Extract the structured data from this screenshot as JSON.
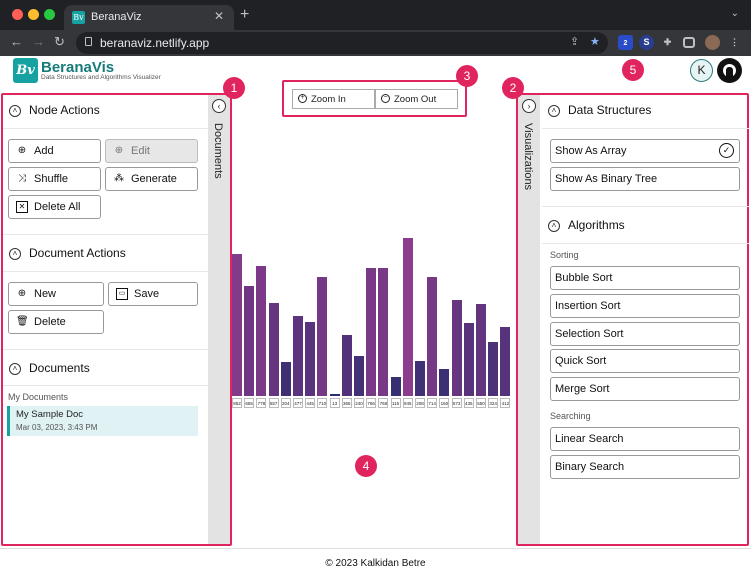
{
  "browser": {
    "tab_title": "BeranaViz",
    "tab_favicon": "Bv",
    "url": "beranaviz.netlify.app",
    "extension_badge": "2",
    "profile_ext_letter": "S"
  },
  "header": {
    "logo_mark": "Bv",
    "title": "BeranaVis",
    "subtitle": "Data Structures and Algorithms Visualizer",
    "avatar_letter": "K",
    "colors": {
      "brand": "#17a2a2",
      "highlight": "#e0245e"
    }
  },
  "left_panel": {
    "strip_label": "Documents",
    "node_actions": {
      "title": "Node Actions",
      "add": "Add",
      "edit": "Edit",
      "shuffle": "Shuffle",
      "generate": "Generate",
      "delete_all": "Delete All"
    },
    "document_actions": {
      "title": "Document Actions",
      "new": "New",
      "save": "Save",
      "delete": "Delete"
    },
    "documents": {
      "title": "Documents",
      "group_label": "My Documents",
      "items": [
        {
          "name": "My Sample Doc",
          "date": "Mar 03, 2023, 3:43 PM"
        }
      ]
    }
  },
  "toolbar": {
    "zoom_in": "Zoom In",
    "zoom_out": "Zoom Out"
  },
  "right_panel": {
    "strip_label": "Visualizations",
    "data_structures": {
      "title": "Data Structures",
      "show_as_array": "Show As Array",
      "show_as_binary_tree": "Show As Binary Tree"
    },
    "algorithms": {
      "title": "Algorithms",
      "sorting_label": "Sorting",
      "sorting": [
        "Bubble Sort",
        "Insertion Sort",
        "Selection Sort",
        "Quick Sort",
        "Merge Sort"
      ],
      "searching_label": "Searching",
      "searching": [
        "Linear Search",
        "Binary Search"
      ]
    }
  },
  "array_values": [
    "852",
    "655",
    "778",
    "557",
    "204",
    "477",
    "445",
    "710",
    "13",
    "365",
    "240",
    "766",
    "768",
    "116",
    "945",
    "208",
    "714",
    "160",
    "573",
    "435",
    "550",
    "324",
    "412"
  ],
  "array_value_numbers": [
    852,
    655,
    778,
    557,
    204,
    477,
    445,
    710,
    13,
    365,
    240,
    766,
    768,
    116,
    945,
    208,
    714,
    160,
    573,
    435,
    550,
    324,
    412
  ],
  "annotations": [
    "1",
    "2",
    "3",
    "4",
    "5"
  ],
  "footer": "© 2023 Kalkidan Betre"
}
